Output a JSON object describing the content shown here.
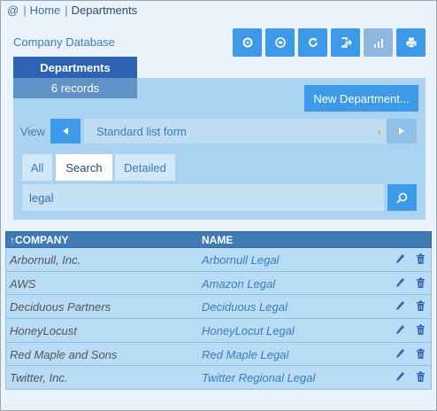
{
  "breadcrumb": {
    "home_icon": "@",
    "home_label": "Home",
    "current": "Departments"
  },
  "database_title": "Company Database",
  "toolbar": {
    "buttons": [
      {
        "icon": "gear-icon"
      },
      {
        "icon": "sync-icon"
      },
      {
        "icon": "refresh-icon"
      },
      {
        "icon": "exit-icon"
      },
      {
        "icon": "chart-icon"
      },
      {
        "icon": "print-icon"
      }
    ]
  },
  "tab": {
    "label": "Departments",
    "records": "6 records"
  },
  "new_button": "New Department...",
  "view": {
    "label": "View",
    "selected": "Standard list form",
    "caret": "‹"
  },
  "search_tabs": [
    "All",
    "Search",
    "Detailed"
  ],
  "search": {
    "value": "legal"
  },
  "table": {
    "headers": [
      "↑COMPANY",
      "NAME"
    ],
    "rows": [
      {
        "company": "Arbornull, Inc.",
        "name": "Arbornull Legal"
      },
      {
        "company": "AWS",
        "name": "Amazon Legal"
      },
      {
        "company": "Deciduous Partners",
        "name": "Deciduous Legal"
      },
      {
        "company": "HoneyLocust",
        "name": "HoneyLocut Legal"
      },
      {
        "company": "Red Maple and Sons",
        "name": "Red Maple Legal"
      },
      {
        "company": "Twitter, Inc.",
        "name": "Twitter Regional Legal"
      }
    ]
  },
  "colors": {
    "accent": "#3d9ae8",
    "header": "#3d7ab6",
    "tab": "#2d62b4"
  }
}
